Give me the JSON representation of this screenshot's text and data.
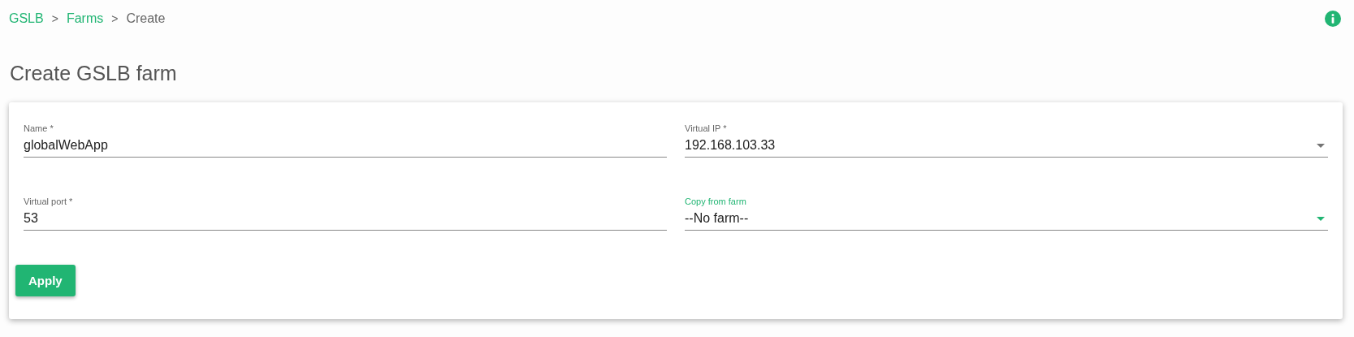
{
  "breadcrumb": [
    {
      "label": "GSLB",
      "kind": "link"
    },
    {
      "label": "Farms",
      "kind": "link"
    },
    {
      "label": "Create",
      "kind": "current"
    }
  ],
  "breadcrumb_separator": ">",
  "page_title": "Create GSLB farm",
  "form": {
    "fields": [
      {
        "label": "Name *",
        "value": "globalWebApp",
        "kind": "text",
        "focused": false
      },
      {
        "label": "Virtual IP *",
        "value": "192.168.103.33",
        "kind": "select",
        "focused": false
      },
      {
        "label": "Virtual port *",
        "value": "53",
        "kind": "text",
        "focused": false
      },
      {
        "label": "Copy from farm",
        "value": "--No farm--",
        "kind": "select",
        "focused": true
      }
    ],
    "submit_button": "Apply"
  }
}
